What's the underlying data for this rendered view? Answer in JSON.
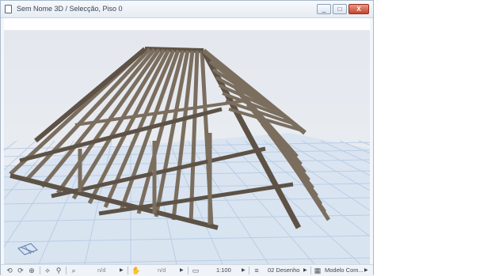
{
  "window": {
    "title": "Sem Nome 3D / Selecção, Piso 0",
    "minimize": "_",
    "maximize": "□",
    "close": "X"
  },
  "statusbar": {
    "value1": "n/d",
    "value2": "n/d",
    "scale": "1:100",
    "layer_combo": "02 Desenho",
    "model_view": "Modelo Com..."
  },
  "icons": {
    "undo": "⟲",
    "redo": "⟳",
    "zoom_in": "⊕",
    "orbit": "⟡",
    "walk": "⚲",
    "zoom": "⌕",
    "pan": "✋",
    "ruler": "▭",
    "layers": "≡",
    "view": "▦"
  },
  "colors": {
    "timber": "#7b6e5e",
    "timber_dark": "#5d5245",
    "grid_line": "#b9cde4",
    "grid_fill": "#d7e3f1"
  }
}
